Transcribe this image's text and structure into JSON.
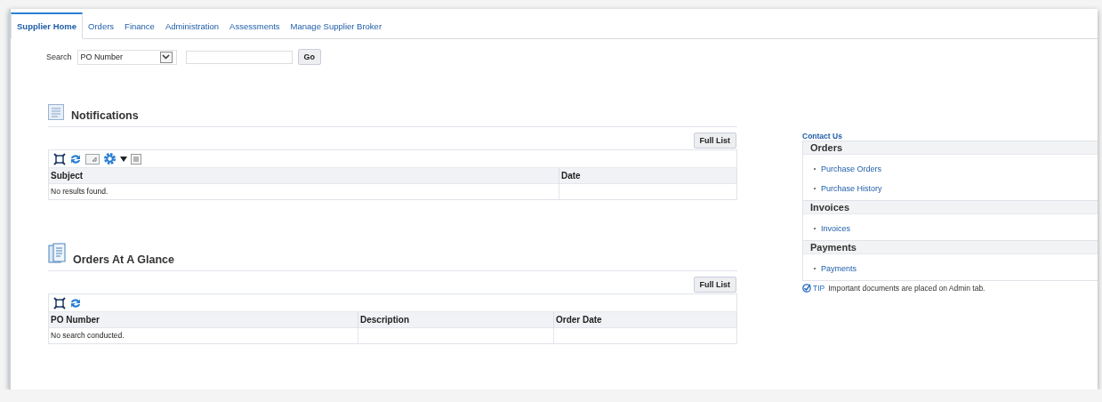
{
  "tabs": [
    {
      "label": "Supplier Home",
      "selected": true
    },
    {
      "label": "Orders",
      "selected": false
    },
    {
      "label": "Finance",
      "selected": false
    },
    {
      "label": "Administration",
      "selected": false
    },
    {
      "label": "Assessments",
      "selected": false
    },
    {
      "label": "Manage Supplier Broker",
      "selected": false
    }
  ],
  "search": {
    "label": "Search",
    "select_value": "PO Number",
    "button": "Go"
  },
  "sections": [
    {
      "kind": "notifications",
      "title": "Notifications",
      "button": "Full List",
      "columns": [
        "Subject",
        "Date"
      ],
      "empty_message": "No results found."
    },
    {
      "kind": "orders",
      "title": "Orders At A Glance",
      "button": "Full List",
      "columns": [
        "PO Number",
        "Description",
        "Order Date"
      ],
      "empty_message": "No search conducted."
    }
  ],
  "sidebar": {
    "contact_link": "Contact Us",
    "groups": [
      {
        "title": "Orders",
        "links": [
          "Purchase Orders",
          "Purchase History"
        ]
      },
      {
        "title": "Invoices",
        "links": [
          "Invoices"
        ]
      },
      {
        "title": "Payments",
        "links": [
          "Payments"
        ]
      }
    ],
    "tip": {
      "label": "TIP",
      "text": "Important documents are placed on Admin tab."
    }
  }
}
